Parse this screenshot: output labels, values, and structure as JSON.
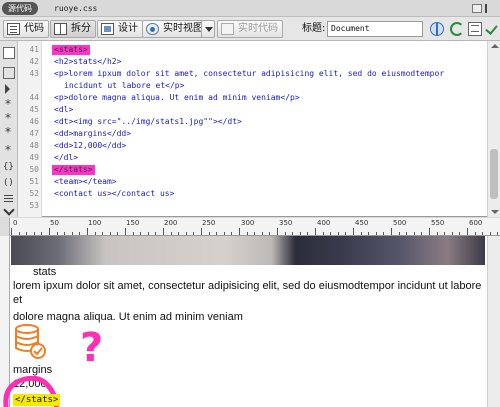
{
  "related_files": {
    "source_label": "源代码",
    "file": "ruoye.css"
  },
  "toolbar": {
    "code_label": "代码",
    "split_label": "拆分",
    "design_label": "设计",
    "live_view_label": "实时视图",
    "live_code_label": "实时代码",
    "title_label": "标题:",
    "title_value": "Document"
  },
  "code": {
    "line_numbers": [
      "41",
      "42",
      "43",
      "",
      "44",
      "45",
      "46",
      "47",
      "48",
      "49",
      "50",
      "51",
      "52",
      "53"
    ],
    "lines": [
      "<stats>",
      "<h2>stats</h2>",
      "<p>lorem ipxum dolor sit amet, consectetur adipisicing elit, sed do eiusmodtempor",
      "incidunt ut labore et</p>",
      "<p>dolore magna aliqua. Ut enim ad minim veniam</p>",
      "<dl>",
      "<dt><img src=\"../img/stats1.jpg\"\"></dt>",
      "<dd>margins</dd>",
      "<dd>12,000</dd>",
      "</dl>",
      "</stats>",
      "<team></team>",
      "<contact us></contact us>",
      ""
    ]
  },
  "ruler": {
    "labels": [
      "0",
      "50",
      "100",
      "150",
      "200",
      "250",
      "300",
      "350",
      "400",
      "450",
      "500",
      "550",
      "600"
    ]
  },
  "design": {
    "heading": "stats",
    "para1": "lorem ipxum dolor sit amet, consectetur adipisicing elit, sed do eiusmodtempor incidunt ut labore et",
    "para2": "dolore magna aliqua. Ut enim ad minim veniam",
    "dd1": "margins",
    "dd2": "12,000",
    "stats_tag": "</stats>",
    "question_mark": "?"
  },
  "colors": {
    "highlight_pink": "#ff33cc",
    "tag_yellow": "#f5e900",
    "code_blue": "#1b1bb5"
  }
}
